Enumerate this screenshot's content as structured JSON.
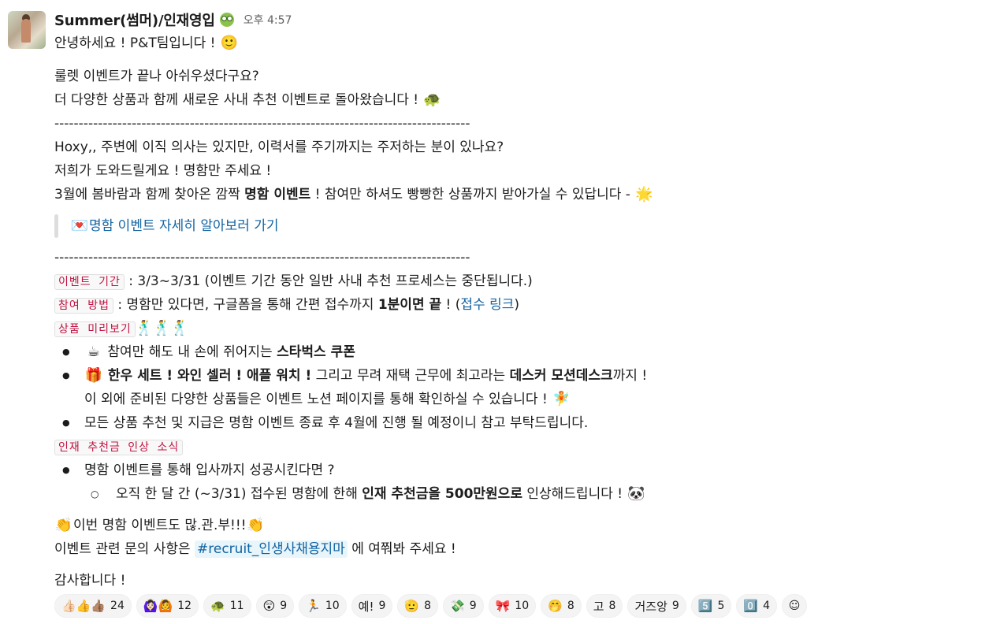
{
  "sender": {
    "name": "Summer(썸머)/인재영입",
    "time": "오후 4:57"
  },
  "lines": {
    "greet": "안녕하세요 ! P&T팀입니다 ! ",
    "l2": "룰렛 이벤트가 끝나 아쉬우셨다구요?",
    "l3": "더 다양한 상품과 함께 새로운 사내 추천 이벤트로 돌아왔습니다 ! ",
    "divider": "--------------------------------------------------------------------------------------",
    "l5": "Hoxy,, 주변에 이직 의사는 있지만, 이력서를 주기까지는 주저하는 분이 있나요?",
    "l6": "저희가 도와드릴게요 ! 명함만 주세요 !",
    "l7a": "3월에 봄바람과 함께 찾아온 깜짝 ",
    "l7b": "명함 이벤트",
    "l7c": " ! 참여만 하셔도 빵빵한 상품까지 받아가실 수 있답니다 - ",
    "quote_link": "명함 이벤트 자세히 알아보러 가기"
  },
  "period": {
    "tag": "이벤트 기간",
    "text": " : 3/3~3/31 (이벤트 기간 동안 일반 사내 추천 프로세스는 중단됩니다.)"
  },
  "join": {
    "tag": "참여 방법",
    "t1": " : 명함만 있다면, 구글폼을 통해 간편 접수까지 ",
    "bold": "1분이면 끝",
    "t2": " ! (",
    "link": "접수 링크",
    "t3": ")"
  },
  "preview": {
    "tag": "상품 미리보기",
    "b1a": " 참여만 해도 내 손에 쥐어지는 ",
    "b1b": "스타벅스 쿠폰",
    "b2a": " 한우 세트 ! 와인 셀러 ! 애플 워치 !",
    "b2b": " 그리고 무려 재택 근무에 최고라는 ",
    "b2c": "데스커 모션데스크",
    "b2d": "까지 !",
    "b2e": "이 외에 준비된 다양한 상품들은 이벤트 노션 페이지를 통해 확인하실 수 있습니다 ! ",
    "b3": "모든 상품 추천 및 지급은 명함 이벤트 종료 후 4월에 진행 될 예정이니 참고 부탁드립니다."
  },
  "bonus": {
    "tag": "인재 추천금 인상 소식",
    "b1": "명함 이벤트를 통해 입사까지 성공시킨다면 ?",
    "s1a": "오직 한 달 간 (~3/31) 접수된 명함에 한해 ",
    "s1b": "인재 추천금을 500만원으로",
    "s1c": " 인상해드립니다 ! "
  },
  "closing": {
    "c1": "이번 명함 이벤트도 많.관.부!!!",
    "c2a": "이벤트 관련 문의 사항은 ",
    "channel": "#recruit_인생사채용지마",
    "c2b": " 에 여쭤봐 주세요 !",
    "c3": "감사합니다 !"
  },
  "reactions": [
    {
      "icon": "👍🏻👍👍🏽",
      "count": "24"
    },
    {
      "icon": "🙆🏻‍♀️🙆",
      "count": "12"
    },
    {
      "icon": "🐢",
      "count": "11"
    },
    {
      "icon": "😲",
      "count": "9"
    },
    {
      "icon": "🏃",
      "count": "10"
    },
    {
      "icon": "예!",
      "count": "9"
    },
    {
      "icon": "🫡",
      "count": "8"
    },
    {
      "icon": "💸",
      "count": "9"
    },
    {
      "icon": "🎀",
      "count": "10"
    },
    {
      "icon": "🤭",
      "count": "8"
    },
    {
      "icon": "고",
      "count": "8"
    },
    {
      "icon": "거즈앙",
      "count": "9"
    },
    {
      "icon": "5️⃣",
      "count": "5"
    },
    {
      "icon": "0️⃣",
      "count": "4"
    }
  ],
  "icons": {
    "smile": "🙂",
    "turtle": "🐢",
    "star": "🌟",
    "letter": "💌",
    "dancers": "🕺🕺🕺",
    "starbucks": "☕",
    "gift": "🎁",
    "fairy": "🧚",
    "panda": "🐼",
    "clap": "👏",
    "add_reaction": "☺"
  }
}
